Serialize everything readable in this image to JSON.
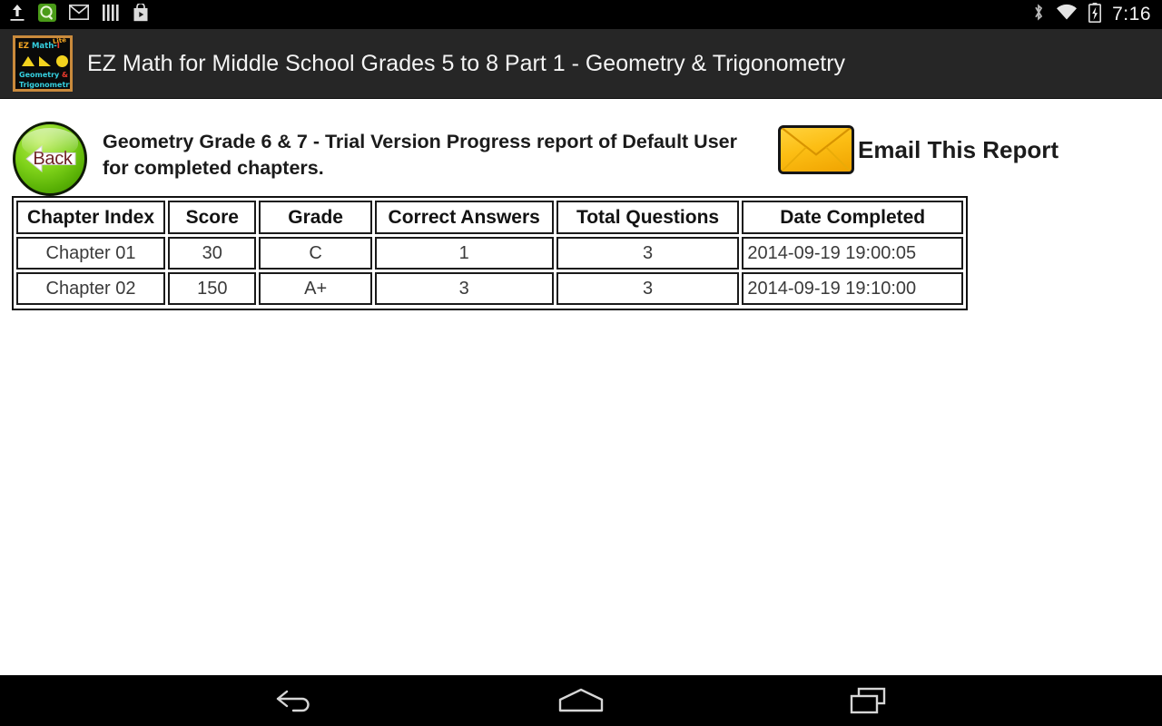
{
  "statusbar": {
    "time": "7:16",
    "left_icons": [
      "upload-icon",
      "app-badge-icon",
      "gmail-icon",
      "bars-icon",
      "play-store-icon"
    ],
    "right_icons": [
      "bluetooth-icon",
      "wifi-icon",
      "battery-charging-icon"
    ]
  },
  "titlebar": {
    "app_title": "EZ Math for Middle School Grades 5 to 8 Part 1 - Geometry & Trigonometry",
    "icon": {
      "line1_ez": "EZ",
      "line1_math": " Math-",
      "line1_numeral": "I",
      "badge": "Lite",
      "line2": "Geometry",
      "line2_amp": "&",
      "line3": "Trigonometry"
    }
  },
  "report": {
    "back_label": "Back",
    "title": "Geometry Grade 6 & 7 - Trial Version Progress report of Default User for completed chapters.",
    "email_label": "Email This Report"
  },
  "table": {
    "headers": [
      "Chapter Index",
      "Score",
      "Grade",
      "Correct Answers",
      "Total Questions",
      "Date Completed"
    ],
    "rows": [
      {
        "chapter": "Chapter 01",
        "score": "30",
        "grade": "C",
        "correct": "1",
        "total": "3",
        "date": "2014-09-19 19:00:05"
      },
      {
        "chapter": "Chapter 02",
        "score": "150",
        "grade": "A+",
        "correct": "3",
        "total": "3",
        "date": "2014-09-19 19:10:00"
      }
    ]
  },
  "navbar": {
    "back": "back-nav-icon",
    "home": "home-nav-icon",
    "recents": "recents-nav-icon"
  },
  "colors": {
    "statusbar_bg": "#000000",
    "titlebar_bg": "#262626",
    "page_bg": "#ffffff",
    "back_button_green": "#7fd21a",
    "envelope_orange": "#fcbe14",
    "icon_border_orange": "#c98a3c",
    "text_dark": "#1b1b1b",
    "cell_text": "#3a3a3a"
  }
}
